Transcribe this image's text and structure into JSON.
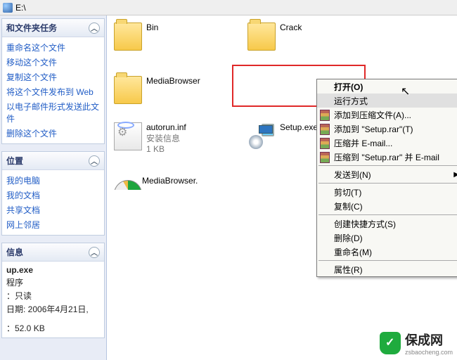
{
  "address": {
    "path": "E:\\"
  },
  "tasks": {
    "files": {
      "title": "和文件夹任务",
      "items": [
        "重命名这个文件",
        "移动这个文件",
        "复制这个文件",
        "将这个文件发布到 Web",
        "以电子邮件形式发送此文件",
        "删除这个文件"
      ]
    },
    "places": {
      "title": "位置",
      "items": [
        "我的电脑",
        "我的文档",
        "共享文档",
        "网上邻居"
      ]
    },
    "info": {
      "title": "信息",
      "name": "up.exe",
      "type": "程序",
      "attr_label": "：只读",
      "date_label": "日期: 2006年4月21日,",
      "size_label": "：52.0 KB"
    }
  },
  "files": {
    "folders": [
      "Bin",
      "Crack",
      "MediaBrowser"
    ],
    "items": [
      {
        "name": "autorun.inf",
        "sub1": "安装信息",
        "sub2": "1 KB"
      },
      {
        "name": "Setup.exe"
      },
      {
        "name": "MediaBrowser."
      }
    ]
  },
  "context_menu": {
    "open": "打开(O)",
    "run_as": "运行方式",
    "add_archive": "添加到压缩文件(A)...",
    "add_setup_rar": "添加到 \"Setup.rar\"(T)",
    "compress_email": "压缩并 E-mail...",
    "compress_setup_email": "压缩到 \"Setup.rar\" 并 E-mail",
    "send_to": "发送到(N)",
    "cut": "剪切(T)",
    "copy": "复制(C)",
    "shortcut": "创建快捷方式(S)",
    "delete": "删除(D)",
    "rename": "重命名(M)",
    "props": "属性(R)"
  },
  "watermark": {
    "text": "保成网",
    "url": "zsbaocheng.com"
  }
}
